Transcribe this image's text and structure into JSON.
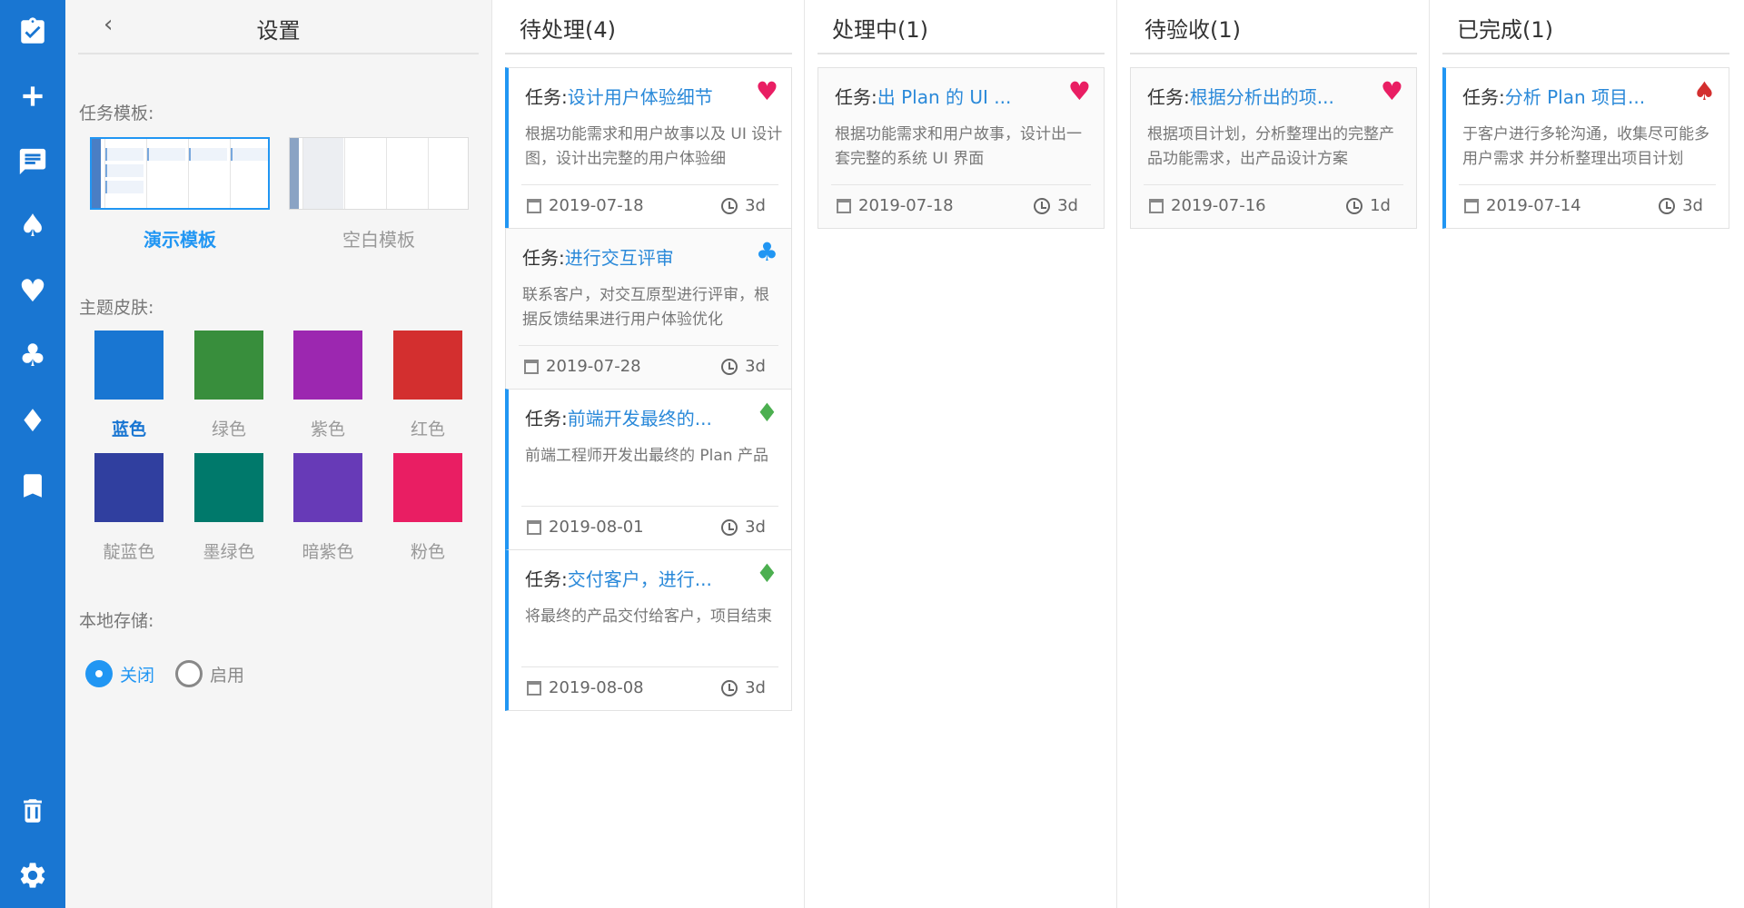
{
  "rail": {
    "icons": [
      "clipboard-check-icon",
      "plus-icon",
      "board-icon",
      "spade-icon",
      "heart-icon",
      "club-icon",
      "diamond-icon",
      "bookmark-icon",
      "trash-icon",
      "gear-icon"
    ],
    "glyphs": {
      "spade": "♠",
      "heart": "♥",
      "club": "♣",
      "diamond": "♦"
    }
  },
  "settings": {
    "back_glyph": "‹",
    "title": "设置",
    "template_label": "任务模板:",
    "templates": [
      {
        "name": "演示模板",
        "selected": true
      },
      {
        "name": "空白模板",
        "selected": false
      }
    ],
    "theme_label": "主题皮肤:",
    "themes": [
      {
        "name": "蓝色",
        "color": "#1976d2",
        "selected": true
      },
      {
        "name": "绿色",
        "color": "#388e3c",
        "selected": false
      },
      {
        "name": "紫色",
        "color": "#9c27b0",
        "selected": false
      },
      {
        "name": "红色",
        "color": "#d32f2f",
        "selected": false
      },
      {
        "name": "靛蓝色",
        "color": "#303f9f",
        "selected": false
      },
      {
        "name": "墨绿色",
        "color": "#00796b",
        "selected": false
      },
      {
        "name": "暗紫色",
        "color": "#673ab7",
        "selected": false
      },
      {
        "name": "粉色",
        "color": "#e91e63",
        "selected": false
      }
    ],
    "storage_label": "本地存储:",
    "storage_options": [
      {
        "label": "关闭",
        "selected": true
      },
      {
        "label": "启用",
        "selected": false
      }
    ]
  },
  "board": {
    "task_prefix": "任务:",
    "columns": [
      {
        "title": "待处理(4)",
        "cards": [
          {
            "name": "设计用户体验细节",
            "suit": "heart",
            "suit_glyph": "♥",
            "suit_color": "#e91e63",
            "desc": "根据功能需求和用户故事以及 UI 设计图，设计出完整的用户体验细",
            "date": "2019-07-18",
            "duration": "3d",
            "accent": true
          },
          {
            "name": "进行交互评审",
            "suit": "club",
            "suit_glyph": "♣",
            "suit_color": "#2196f3",
            "desc": "联系客户，对交互原型进行评审，根据反馈结果进行用户体验优化",
            "date": "2019-07-28",
            "duration": "3d",
            "accent": false
          },
          {
            "name": "前端开发最终的...",
            "suit": "diamond",
            "suit_glyph": "♦",
            "suit_color": "#4caf50",
            "desc": "前端工程师开发出最终的 Plan 产品",
            "date": "2019-08-01",
            "duration": "3d",
            "accent": true
          },
          {
            "name": "交付客户，进行...",
            "suit": "diamond",
            "suit_glyph": "♦",
            "suit_color": "#4caf50",
            "desc": "将最终的产品交付给客户，项目结束",
            "date": "2019-08-08",
            "duration": "3d",
            "accent": true
          }
        ]
      },
      {
        "title": "处理中(1)",
        "cards": [
          {
            "name": "出 Plan 的 UI ...",
            "suit": "heart",
            "suit_glyph": "♥",
            "suit_color": "#e91e63",
            "desc": "根据功能需求和用户故事，设计出一套完整的系统 UI 界面",
            "date": "2019-07-18",
            "duration": "3d",
            "accent": false
          }
        ]
      },
      {
        "title": "待验收(1)",
        "cards": [
          {
            "name": "根据分析出的项...",
            "suit": "heart",
            "suit_glyph": "♥",
            "suit_color": "#e91e63",
            "desc": "根据项目计划，分析整理出的完整产品功能需求，出产品设计方案",
            "date": "2019-07-16",
            "duration": "1d",
            "accent": false
          }
        ]
      },
      {
        "title": "已完成(1)",
        "cards": [
          {
            "name": "分析 Plan 项目...",
            "suit": "spade",
            "suit_glyph": "♠",
            "suit_color": "#d32f2f",
            "desc": "于客户进行多轮沟通，收集尽可能多用户需求 并分析整理出项目计划",
            "date": "2019-07-14",
            "duration": "3d",
            "accent": true
          }
        ]
      }
    ]
  }
}
